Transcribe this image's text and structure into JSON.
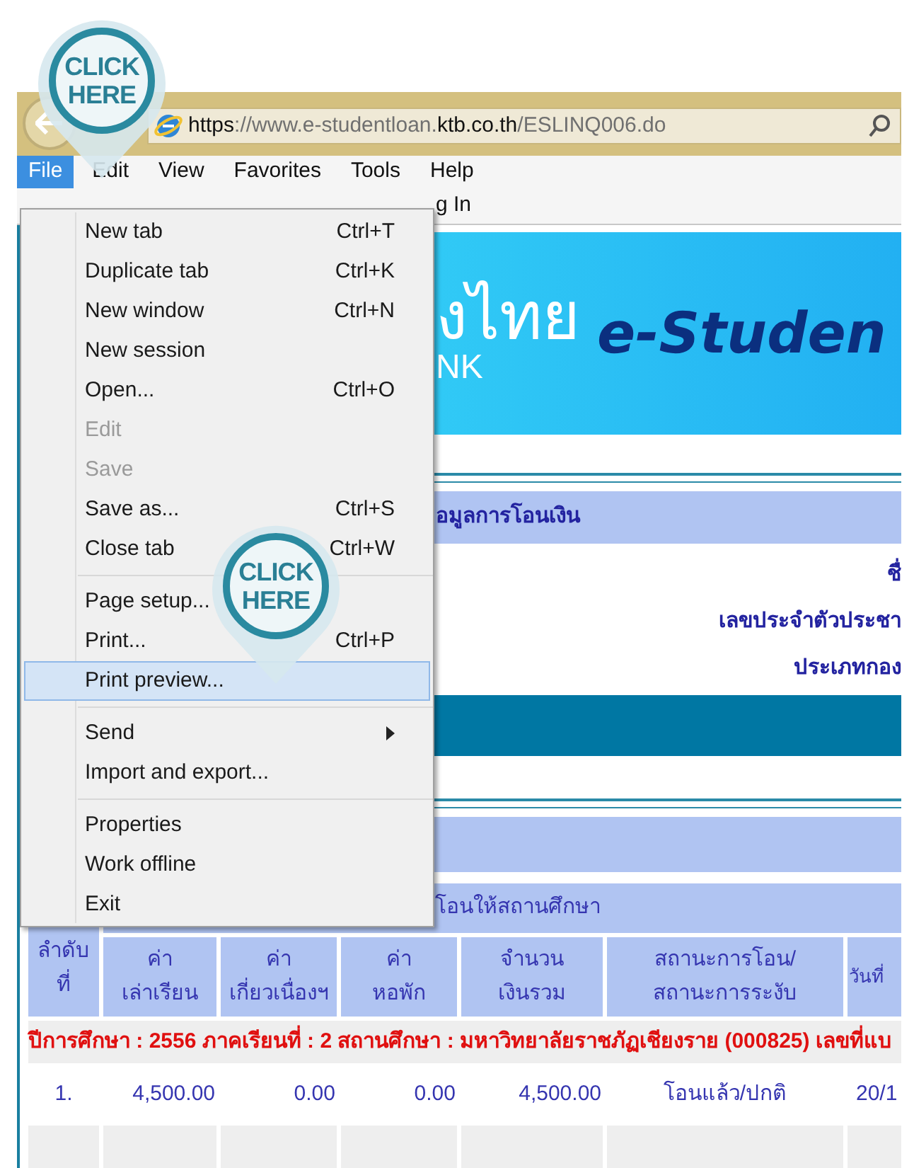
{
  "browser": {
    "address_bar": {
      "url_parts": [
        {
          "text": "https",
          "emphasis": true
        },
        {
          "text": "://www.e-studentloan.",
          "emphasis": false
        },
        {
          "text": "ktb.co.th",
          "emphasis": true
        },
        {
          "text": "/ESLINQ006.do",
          "emphasis": false
        }
      ]
    },
    "menu_bar": [
      {
        "label": "File",
        "selected": true
      },
      {
        "label": "Edit",
        "selected": false
      },
      {
        "label": "View",
        "selected": false
      },
      {
        "label": "Favorites",
        "selected": false
      },
      {
        "label": "Tools",
        "selected": false
      },
      {
        "label": "Help",
        "selected": false
      }
    ],
    "command_bar": {
      "visible_text": "g In"
    }
  },
  "file_menu": {
    "items": [
      {
        "kind": "item",
        "label": "New tab",
        "shortcut": "Ctrl+T",
        "disabled": false,
        "selected": false,
        "submenu": false
      },
      {
        "kind": "item",
        "label": "Duplicate tab",
        "shortcut": "Ctrl+K",
        "disabled": false,
        "selected": false,
        "submenu": false
      },
      {
        "kind": "item",
        "label": "New window",
        "shortcut": "Ctrl+N",
        "disabled": false,
        "selected": false,
        "submenu": false
      },
      {
        "kind": "item",
        "label": "New session",
        "disabled": false,
        "selected": false,
        "submenu": false
      },
      {
        "kind": "item",
        "label": "Open...",
        "shortcut": "Ctrl+O",
        "disabled": false,
        "selected": false,
        "submenu": false
      },
      {
        "kind": "item",
        "label": "Edit",
        "disabled": true,
        "selected": false,
        "submenu": false
      },
      {
        "kind": "item",
        "label": "Save",
        "disabled": true,
        "selected": false,
        "submenu": false
      },
      {
        "kind": "item",
        "label": "Save as...",
        "shortcut": "Ctrl+S",
        "disabled": false,
        "selected": false,
        "submenu": false
      },
      {
        "kind": "item",
        "label": "Close tab",
        "shortcut": "Ctrl+W",
        "disabled": false,
        "selected": false,
        "submenu": false
      },
      {
        "kind": "separator"
      },
      {
        "kind": "item",
        "label": "Page setup...",
        "disabled": false,
        "selected": false,
        "submenu": false
      },
      {
        "kind": "item",
        "label": "Print...",
        "shortcut": "Ctrl+P",
        "disabled": false,
        "selected": false,
        "submenu": false
      },
      {
        "kind": "item",
        "label": "Print preview...",
        "disabled": false,
        "selected": true,
        "submenu": false
      },
      {
        "kind": "separator"
      },
      {
        "kind": "item",
        "label": "Send",
        "disabled": false,
        "selected": false,
        "submenu": true
      },
      {
        "kind": "item",
        "label": "Import and export...",
        "disabled": false,
        "selected": false,
        "submenu": false
      },
      {
        "kind": "separator"
      },
      {
        "kind": "item",
        "label": "Properties",
        "disabled": false,
        "selected": false,
        "submenu": false
      },
      {
        "kind": "item",
        "label": "Work offline",
        "disabled": false,
        "selected": false,
        "submenu": false
      },
      {
        "kind": "item",
        "label": "Exit",
        "disabled": false,
        "selected": false,
        "submenu": false
      }
    ]
  },
  "callouts": [
    {
      "text": "CLICK HERE"
    },
    {
      "text": "CLICK HERE"
    }
  ],
  "page": {
    "banner": {
      "bank_name": "งไทย",
      "bank_name_en": "NK",
      "product": "e-Studen"
    },
    "section_title": "อมูลการโอนเงิน",
    "info_labels": [
      "ชื่",
      "เลขประจำตัวประชา",
      "ประเภทกอง"
    ],
    "table": {
      "group_header": "โอนให้สถานศึกษา",
      "columns": [
        "ลำดับ\nที่",
        "ค่า\nเล่าเรียน",
        "ค่า\nเกี่ยวเนื่องฯ",
        "ค่า\nหอพัก",
        "จำนวน\nเงินรวม",
        "สถานะการโอน/\nสถานะการระงับ",
        "วันที่"
      ],
      "group_row": "ปีการศึกษา : 2556 ภาคเรียนที่ : 2 สถานศึกษา : มหาวิทยาลัยราชภัฏเชียงราย (000825) เลขที่แบ",
      "rows": [
        [
          "1.",
          "4,500.00",
          "0.00",
          "0.00",
          "4,500.00",
          "โอนแล้ว/ปกติ",
          "20/1"
        ]
      ]
    }
  }
}
